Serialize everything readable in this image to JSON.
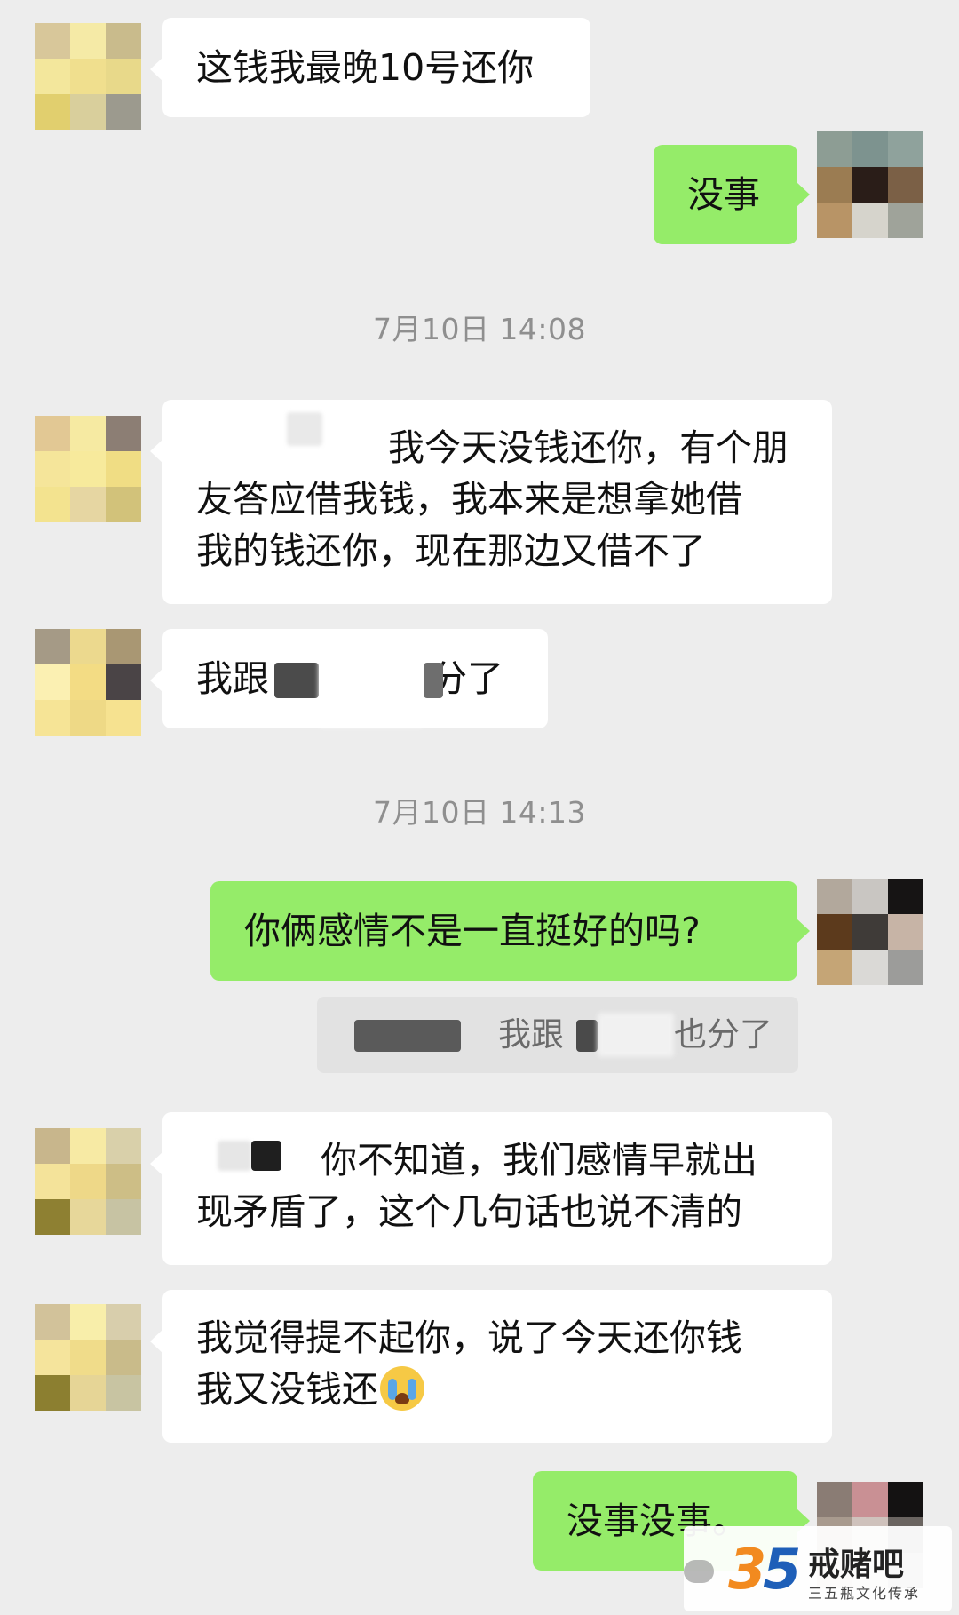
{
  "messages": {
    "m1": {
      "lines": [
        "这钱我最晚10号还你"
      ]
    },
    "m2": {
      "lines": [
        "没事"
      ]
    },
    "ts1": "7月10日 14:08",
    "m3": {
      "lines": [
        "我今天没钱还你，有个朋",
        "友答应借我钱，我本来是想拿她借",
        "我的钱还你，现在那边又借不了"
      ]
    },
    "m4": {
      "prefix": "我跟",
      "suffix": "分了"
    },
    "ts2": "7月10日 14:13",
    "m5": {
      "lines": [
        "你俩感情不是一直挺好的吗?"
      ]
    },
    "quote": {
      "prefix": "我跟",
      "suffix": "也分了"
    },
    "m6": {
      "lines": [
        "你不知道，我们感情早就出",
        "现矛盾了，这个几句话也说不清的"
      ]
    },
    "m7": {
      "lines": [
        "我觉得提不起你，说了今天还你钱",
        "我又没钱还"
      ]
    },
    "m8": {
      "lines": [
        "没事没事。"
      ]
    }
  },
  "icons": {
    "crying_emoji": "loudly-crying-face-icon",
    "wechat": "wechat-icon"
  },
  "watermark": {
    "number_3": "3",
    "number_5": "5",
    "title": "戒赌吧",
    "subtitle": "三五瓶文化传承"
  },
  "colors": {
    "background": "#ededed",
    "incoming_bubble": "#ffffff",
    "outgoing_bubble": "#95ec69",
    "timestamp_text": "#8f8f8f"
  }
}
